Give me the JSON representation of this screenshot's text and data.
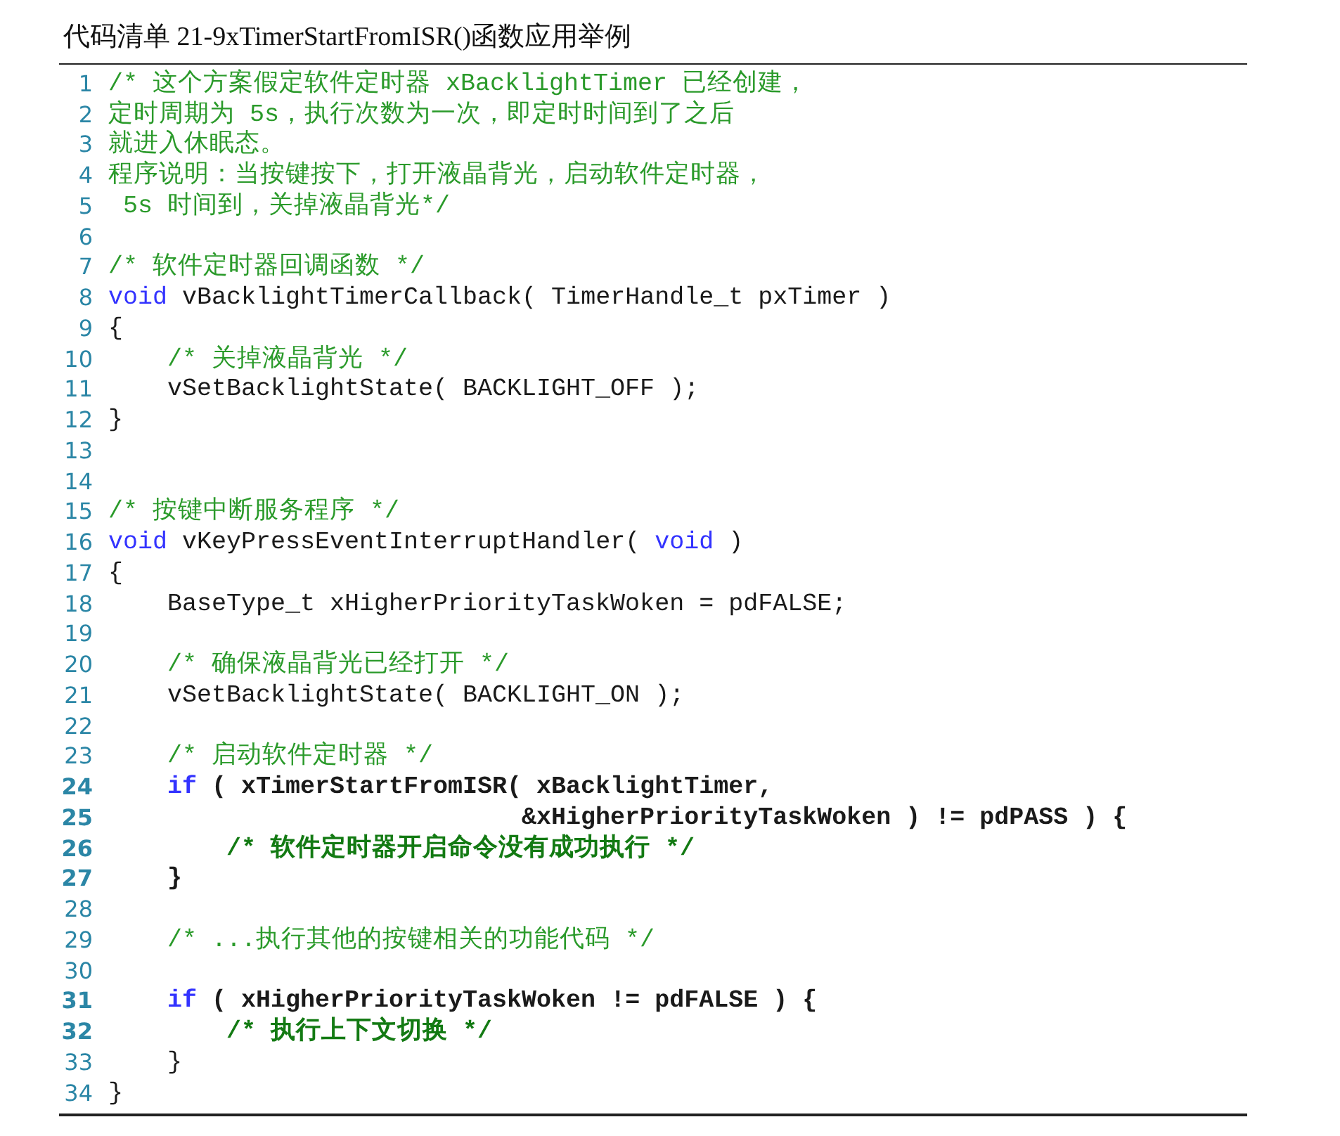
{
  "title": "代码清单 21-9xTimerStartFromISR()函数应用举例",
  "lines": [
    {
      "number": "1",
      "bold": false,
      "tokens": [
        {
          "kind": "comment",
          "text": "/* 这个方案假定软件定时器 xBacklightTimer 已经创建，"
        }
      ]
    },
    {
      "number": "2",
      "bold": false,
      "tokens": [
        {
          "kind": "comment",
          "text": "定时周期为 5s，执行次数为一次，即定时时间到了之后"
        }
      ]
    },
    {
      "number": "3",
      "bold": false,
      "tokens": [
        {
          "kind": "comment",
          "text": "就进入休眠态。"
        }
      ]
    },
    {
      "number": "4",
      "bold": false,
      "tokens": [
        {
          "kind": "comment",
          "text": "程序说明：当按键按下，打开液晶背光，启动软件定时器，"
        }
      ]
    },
    {
      "number": "5",
      "bold": false,
      "tokens": [
        {
          "kind": "comment",
          "text": " 5s 时间到，关掉液晶背光*/"
        }
      ]
    },
    {
      "number": "6",
      "bold": false
    },
    {
      "number": "7",
      "bold": false,
      "tokens": [
        {
          "kind": "comment",
          "text": "/* 软件定时器回调函数 */"
        }
      ]
    },
    {
      "number": "8",
      "bold": false,
      "tokens": [
        {
          "kind": "keyword",
          "text": "void"
        },
        {
          "kind": "code",
          "text": " vBacklightTimerCallback( TimerHandle_t pxTimer )"
        }
      ]
    },
    {
      "number": "9",
      "bold": false,
      "tokens": [
        {
          "kind": "code",
          "text": "{"
        }
      ]
    },
    {
      "number": "10",
      "bold": false,
      "tokens": [
        {
          "kind": "comment",
          "text": "    /* 关掉液晶背光 */"
        }
      ]
    },
    {
      "number": "11",
      "bold": false,
      "tokens": [
        {
          "kind": "code",
          "text": "    vSetBacklightState( BACKLIGHT_OFF );"
        }
      ]
    },
    {
      "number": "12",
      "bold": false,
      "tokens": [
        {
          "kind": "code",
          "text": "}"
        }
      ]
    },
    {
      "number": "13",
      "bold": false
    },
    {
      "number": "14",
      "bold": false
    },
    {
      "number": "15",
      "bold": false,
      "tokens": [
        {
          "kind": "comment",
          "text": "/* 按键中断服务程序 */"
        }
      ]
    },
    {
      "number": "16",
      "bold": false,
      "tokens": [
        {
          "kind": "keyword",
          "text": "void"
        },
        {
          "kind": "code",
          "text": " vKeyPressEventInterruptHandler( "
        },
        {
          "kind": "keyword",
          "text": "void"
        },
        {
          "kind": "code",
          "text": " )"
        }
      ]
    },
    {
      "number": "17",
      "bold": false,
      "tokens": [
        {
          "kind": "code",
          "text": "{"
        }
      ]
    },
    {
      "number": "18",
      "bold": false,
      "tokens": [
        {
          "kind": "code",
          "text": "    BaseType_t xHigherPriorityTaskWoken = pdFALSE;"
        }
      ]
    },
    {
      "number": "19",
      "bold": false
    },
    {
      "number": "20",
      "bold": false,
      "tokens": [
        {
          "kind": "comment",
          "text": "    /* 确保液晶背光已经打开 */"
        }
      ]
    },
    {
      "number": "21",
      "bold": false,
      "tokens": [
        {
          "kind": "code",
          "text": "    vSetBacklightState( BACKLIGHT_ON );"
        }
      ]
    },
    {
      "number": "22",
      "bold": false
    },
    {
      "number": "23",
      "bold": false,
      "tokens": [
        {
          "kind": "comment",
          "text": "    /* 启动软件定时器 */"
        }
      ]
    },
    {
      "number": "24",
      "bold": true,
      "tokens": [
        {
          "kind": "keyword",
          "text": "    if"
        },
        {
          "kind": "code",
          "text": " ( xTimerStartFromISR( xBacklightTimer,"
        }
      ]
    },
    {
      "number": "25",
      "bold": true,
      "tokens": [
        {
          "kind": "code",
          "text": "                            &xHigherPriorityTaskWoken ) != pdPASS ) {"
        }
      ]
    },
    {
      "number": "26",
      "bold": true,
      "tokens": [
        {
          "kind": "comment",
          "text": "        /* 软件定时器开启命令没有成功执行 */"
        }
      ]
    },
    {
      "number": "27",
      "bold": true,
      "tokens": [
        {
          "kind": "code",
          "text": "    }"
        }
      ]
    },
    {
      "number": "28",
      "bold": false
    },
    {
      "number": "29",
      "bold": false,
      "tokens": [
        {
          "kind": "comment",
          "text": "    /* ...执行其他的按键相关的功能代码 */"
        }
      ]
    },
    {
      "number": "30",
      "bold": false
    },
    {
      "number": "31",
      "bold": true,
      "tokens": [
        {
          "kind": "keyword",
          "text": "    if"
        },
        {
          "kind": "code",
          "text": " ( xHigherPriorityTaskWoken != pdFALSE ) {"
        }
      ]
    },
    {
      "number": "32",
      "bold": true,
      "tokens": [
        {
          "kind": "comment",
          "text": "        /* 执行上下文切换 */"
        }
      ]
    },
    {
      "number": "33",
      "bold": false,
      "tokens": [
        {
          "kind": "code",
          "text": "    }"
        }
      ]
    },
    {
      "number": "34",
      "bold": false,
      "tokens": [
        {
          "kind": "code",
          "text": "}"
        }
      ]
    }
  ]
}
